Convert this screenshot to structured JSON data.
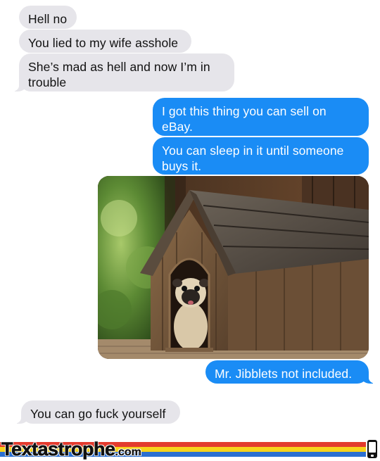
{
  "conversation": {
    "messages": [
      {
        "side": "incoming",
        "text": "Hell no"
      },
      {
        "side": "incoming",
        "text": "You lied to my wife asshole"
      },
      {
        "side": "incoming",
        "text": "She’s mad as hell and now I’m in trouble"
      },
      {
        "side": "outgoing",
        "text": "I got this thing you can sell on eBay."
      },
      {
        "side": "outgoing",
        "text": "You can sleep in it until someone buys it."
      },
      {
        "side": "outgoing",
        "type": "photo",
        "image": "pug-in-wooden-doghouse"
      },
      {
        "side": "outgoing",
        "text": "Mr. Jibblets not included."
      },
      {
        "side": "incoming",
        "text": "You can go fuck yourself"
      }
    ]
  },
  "footer": {
    "brand": "Textastrophe",
    "brand_suffix": ".com",
    "icon": "phone-icon"
  },
  "colors": {
    "incoming_bubble": "#e6e5ea",
    "outgoing_bubble": "#1a8cf5",
    "stripe_red": "#e33b2e",
    "stripe_yellow": "#f7d21c",
    "stripe_blue": "#2b6fd1"
  }
}
